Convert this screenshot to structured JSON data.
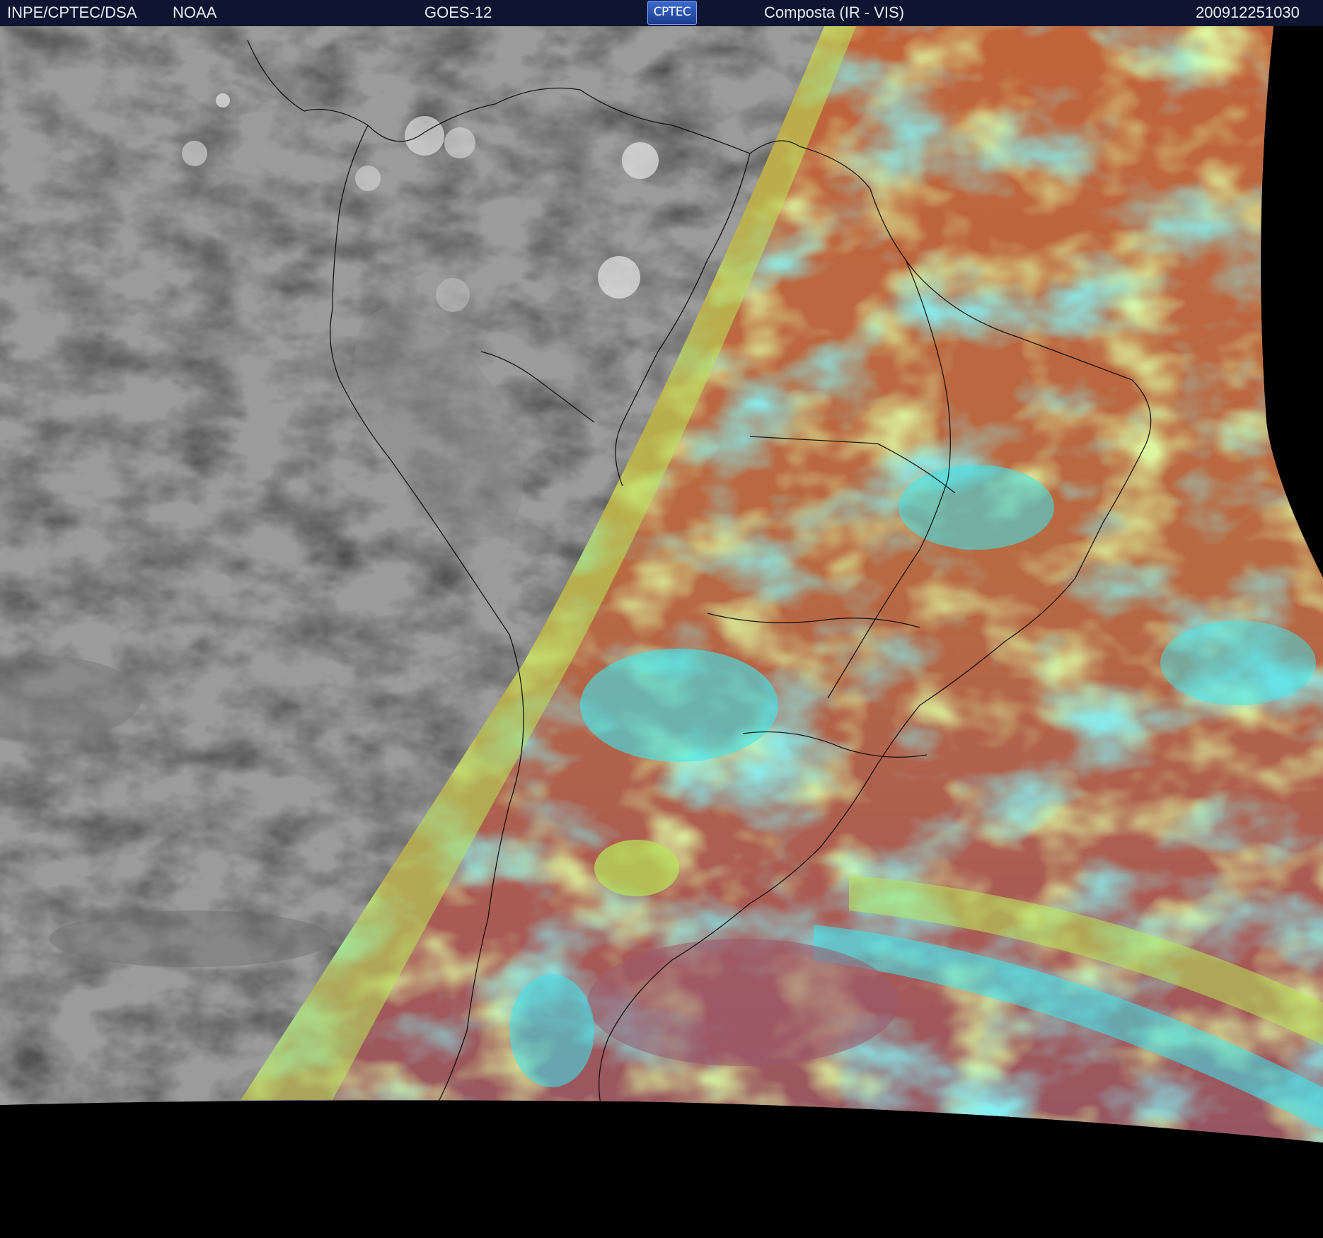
{
  "header": {
    "agency": "INPE/CPTEC/DSA",
    "partner": "NOAA",
    "satellite": "GOES-12",
    "logo_text": "CPTEC",
    "product": "Composta (IR - VIS)",
    "timestamp": "200912251030"
  },
  "colors": {
    "header_bg": "#0d1530",
    "ir_gray": "#4a4a4a",
    "vis_red": "#b06045",
    "vis_green": "#b8e85a",
    "vis_cyan": "#3de8f0",
    "vis_magenta": "#9a5a6e",
    "outline": "#000000"
  }
}
